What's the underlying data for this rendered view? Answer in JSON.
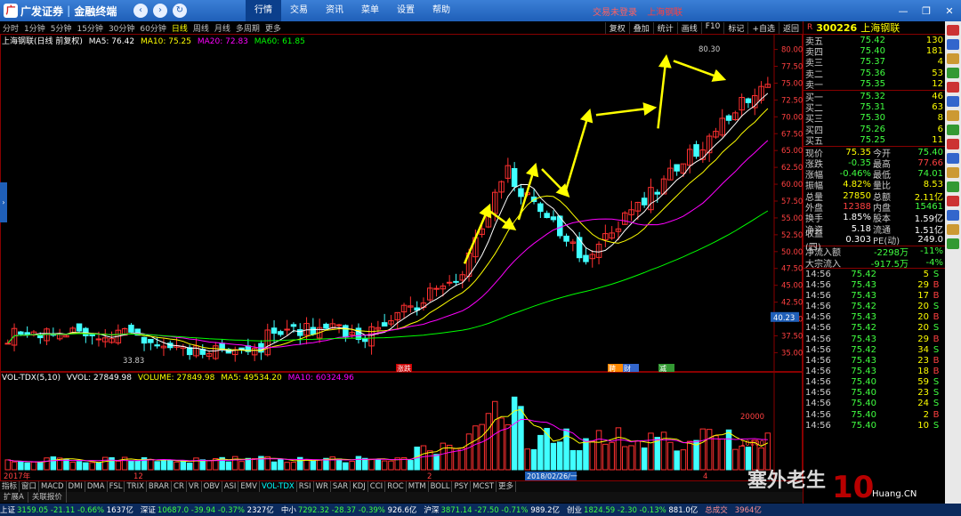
{
  "app": {
    "brand": "广发证券",
    "product": "金融终端",
    "menu": [
      "行情",
      "交易",
      "资讯",
      "菜单",
      "设置",
      "帮助"
    ],
    "active_menu": "行情",
    "trade_status": "交易未登录",
    "trade_stock": "上海钢联",
    "window_buttons": [
      "—",
      "❐",
      "✕"
    ]
  },
  "periods": {
    "items": [
      "分时",
      "1分钟",
      "5分钟",
      "15分钟",
      "30分钟",
      "60分钟",
      "日线",
      "周线",
      "月线",
      "多周期",
      "更多"
    ],
    "active": "日线",
    "tools": [
      "复权",
      "叠加",
      "统计",
      "画线",
      "F10",
      "标记",
      "+自选",
      "返回"
    ]
  },
  "main_legend": {
    "name": "上海钢联(日线 前复权)",
    "ma5": "MA5: 76.42",
    "ma10": "MA10: 75.25",
    "ma20": "MA20: 72.83",
    "ma60": "MA60: 61.85"
  },
  "price_axis": [
    "80.00",
    "77.50",
    "75.00",
    "72.50",
    "70.00",
    "67.50",
    "65.00",
    "62.50",
    "60.00",
    "57.50",
    "55.00",
    "52.50",
    "50.00",
    "47.50",
    "45.00",
    "42.50",
    "40.00",
    "37.50",
    "35.00"
  ],
  "price_marker": "40.23",
  "high_label": "80.30",
  "low_label": "33.83",
  "event_tags": [
    "涨跌",
    "聘",
    "财",
    "减"
  ],
  "vol_legend": {
    "name": "VOL-TDX(5,10)",
    "vvol": "VVOL: 27849.98",
    "volume": "VOLUME: 27849.98",
    "ma5": "MA5: 49534.20",
    "ma10": "MA10: 60324.96"
  },
  "vol_axis": [
    "20000",
    "10000"
  ],
  "time_axis": [
    "2017年",
    "12",
    "2",
    "3",
    "4"
  ],
  "date_marker": "2018/02/26/一",
  "indicators": [
    "指标",
    "窗口",
    "MACD",
    "DMI",
    "DMA",
    "FSL",
    "TRIX",
    "BRAR",
    "CR",
    "VR",
    "OBV",
    "ASI",
    "EMV",
    "VOL-TDX",
    "RSI",
    "WR",
    "SAR",
    "KDJ",
    "CCI",
    "ROC",
    "MTM",
    "BOLL",
    "PSY",
    "MCST",
    "更多"
  ],
  "active_indicator": "VOL-TDX",
  "ext_tabs": [
    "扩展A",
    "关联报价"
  ],
  "stock": {
    "prefix": "R",
    "code": "300226",
    "name": "上海钢联"
  },
  "asks": [
    {
      "label": "卖五",
      "price": "75.42",
      "vol": "130"
    },
    {
      "label": "卖四",
      "price": "75.40",
      "vol": "181"
    },
    {
      "label": "卖三",
      "price": "75.37",
      "vol": "4"
    },
    {
      "label": "卖二",
      "price": "75.36",
      "vol": "53"
    },
    {
      "label": "卖一",
      "price": "75.35",
      "vol": "12"
    }
  ],
  "bids": [
    {
      "label": "买一",
      "price": "75.32",
      "vol": "46"
    },
    {
      "label": "买二",
      "price": "75.31",
      "vol": "63"
    },
    {
      "label": "买三",
      "price": "75.30",
      "vol": "8"
    },
    {
      "label": "买四",
      "price": "75.26",
      "vol": "6"
    },
    {
      "label": "买五",
      "price": "75.25",
      "vol": "11"
    }
  ],
  "quote": [
    {
      "l1": "现价",
      "v1": "75.35",
      "l2": "今开",
      "v2": "75.40"
    },
    {
      "l1": "涨跌",
      "v1": "-0.35",
      "l2": "最高",
      "v2": "77.66"
    },
    {
      "l1": "涨幅",
      "v1": "-0.46%",
      "l2": "最低",
      "v2": "74.01"
    },
    {
      "l1": "振幅",
      "v1": "4.82%",
      "l2": "量比",
      "v2": "8.53"
    },
    {
      "l1": "总量",
      "v1": "27850",
      "l2": "总额",
      "v2": "2.11亿"
    },
    {
      "l1": "外盘",
      "v1": "12388",
      "l2": "内盘",
      "v2": "15461"
    },
    {
      "l1": "换手",
      "v1": "1.85%",
      "l2": "股本",
      "v2": "1.59亿"
    },
    {
      "l1": "净资",
      "v1": "5.18",
      "l2": "流通",
      "v2": "1.51亿"
    },
    {
      "l1": "收益(四)",
      "v1": "0.303",
      "l2": "PE(动)",
      "v2": "249.0"
    }
  ],
  "flows": [
    {
      "label": "净流入额",
      "value": "-2298万",
      "pct": "-11%"
    },
    {
      "label": "大宗流入",
      "value": "-917.5万",
      "pct": "-4%"
    }
  ],
  "ticks": [
    {
      "t": "14:56",
      "p": "75.42",
      "v": "5",
      "d": "S"
    },
    {
      "t": "14:56",
      "p": "75.43",
      "v": "29",
      "d": "B"
    },
    {
      "t": "14:56",
      "p": "75.43",
      "v": "17",
      "d": "B"
    },
    {
      "t": "14:56",
      "p": "75.42",
      "v": "20",
      "d": "S"
    },
    {
      "t": "14:56",
      "p": "75.43",
      "v": "20",
      "d": "B"
    },
    {
      "t": "14:56",
      "p": "75.42",
      "v": "20",
      "d": "S"
    },
    {
      "t": "14:56",
      "p": "75.43",
      "v": "29",
      "d": "B"
    },
    {
      "t": "14:56",
      "p": "75.42",
      "v": "34",
      "d": "S"
    },
    {
      "t": "14:56",
      "p": "75.43",
      "v": "23",
      "d": "B"
    },
    {
      "t": "14:56",
      "p": "75.43",
      "v": "18",
      "d": "B"
    },
    {
      "t": "14:56",
      "p": "75.40",
      "v": "59",
      "d": "S"
    },
    {
      "t": "14:56",
      "p": "75.40",
      "v": "23",
      "d": "S"
    },
    {
      "t": "14:56",
      "p": "75.40",
      "v": "24",
      "d": "S"
    },
    {
      "t": "14:56",
      "p": "75.40",
      "v": "2",
      "d": "B"
    },
    {
      "t": "14:56",
      "p": "75.40",
      "v": "10",
      "d": "S"
    }
  ],
  "index_bar": [
    {
      "name": "上证",
      "val": "3159.05",
      "chg": "-21.11",
      "pct": "-0.66%",
      "amt": "1637亿",
      "dir": "dn"
    },
    {
      "name": "深证",
      "val": "10687.0",
      "chg": "-39.94",
      "pct": "-0.37%",
      "amt": "2327亿",
      "dir": "dn"
    },
    {
      "name": "中小",
      "val": "7292.32",
      "chg": "-28.37",
      "pct": "-0.39%",
      "amt": "926.6亿",
      "dir": "dn"
    },
    {
      "name": "沪深",
      "val": "3871.14",
      "chg": "-27.50",
      "pct": "-0.71%",
      "amt": "989.2亿",
      "dir": "dn"
    },
    {
      "name": "创业",
      "val": "1824.59",
      "chg": "-2.30",
      "pct": "-0.13%",
      "amt": "881.0亿",
      "dir": "dn"
    }
  ],
  "index_misc": [
    "总成交",
    "3964亿"
  ],
  "watermark": "塞外老生",
  "watermark_site": "Huang.CN",
  "colors": {
    "up": "#ff3030",
    "down": "#40ffff",
    "ma5": "#ffffff",
    "ma10": "#ffff00",
    "ma20": "#ff00ff",
    "ma60": "#00ff00",
    "arrow": "#ffff00"
  }
}
